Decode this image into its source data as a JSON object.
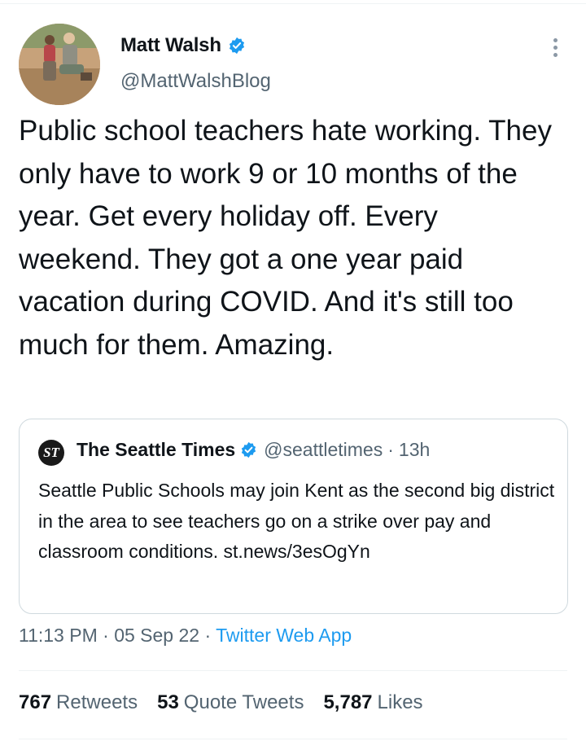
{
  "author": {
    "display_name": "Matt Walsh",
    "handle": "@MattWalshBlog",
    "verified": true
  },
  "tweet": {
    "text": "Public school teachers hate working. They only have to work 9 or 10 months of the year. Get every holiday off. Every weekend. They got a one year paid vacation during COVID. And it's still too much for them. Amazing."
  },
  "quoted_tweet": {
    "logo_text": "ST",
    "display_name": "The Seattle Times",
    "handle": "@seattletimes",
    "separator": "·",
    "age": "13h",
    "text": "Seattle Public Schools may join Kent as the second big district in the area to see teachers go on a strike over pay and classroom conditions. st.news/3esOgYn"
  },
  "meta": {
    "time": "11:13 PM",
    "separator": "·",
    "date": "05 Sep 22",
    "separator2": "·",
    "source": "Twitter Web App"
  },
  "stats": [
    {
      "count": "767",
      "label": "Retweets"
    },
    {
      "count": "53",
      "label": "Quote Tweets"
    },
    {
      "count": "5,787",
      "label": "Likes"
    }
  ],
  "colors": {
    "accent": "#1d9bf0",
    "secondary_text": "#536471",
    "border": "#cfd9de"
  },
  "icons": {
    "verified": "verified-badge-icon",
    "more": "more-options-icon"
  }
}
